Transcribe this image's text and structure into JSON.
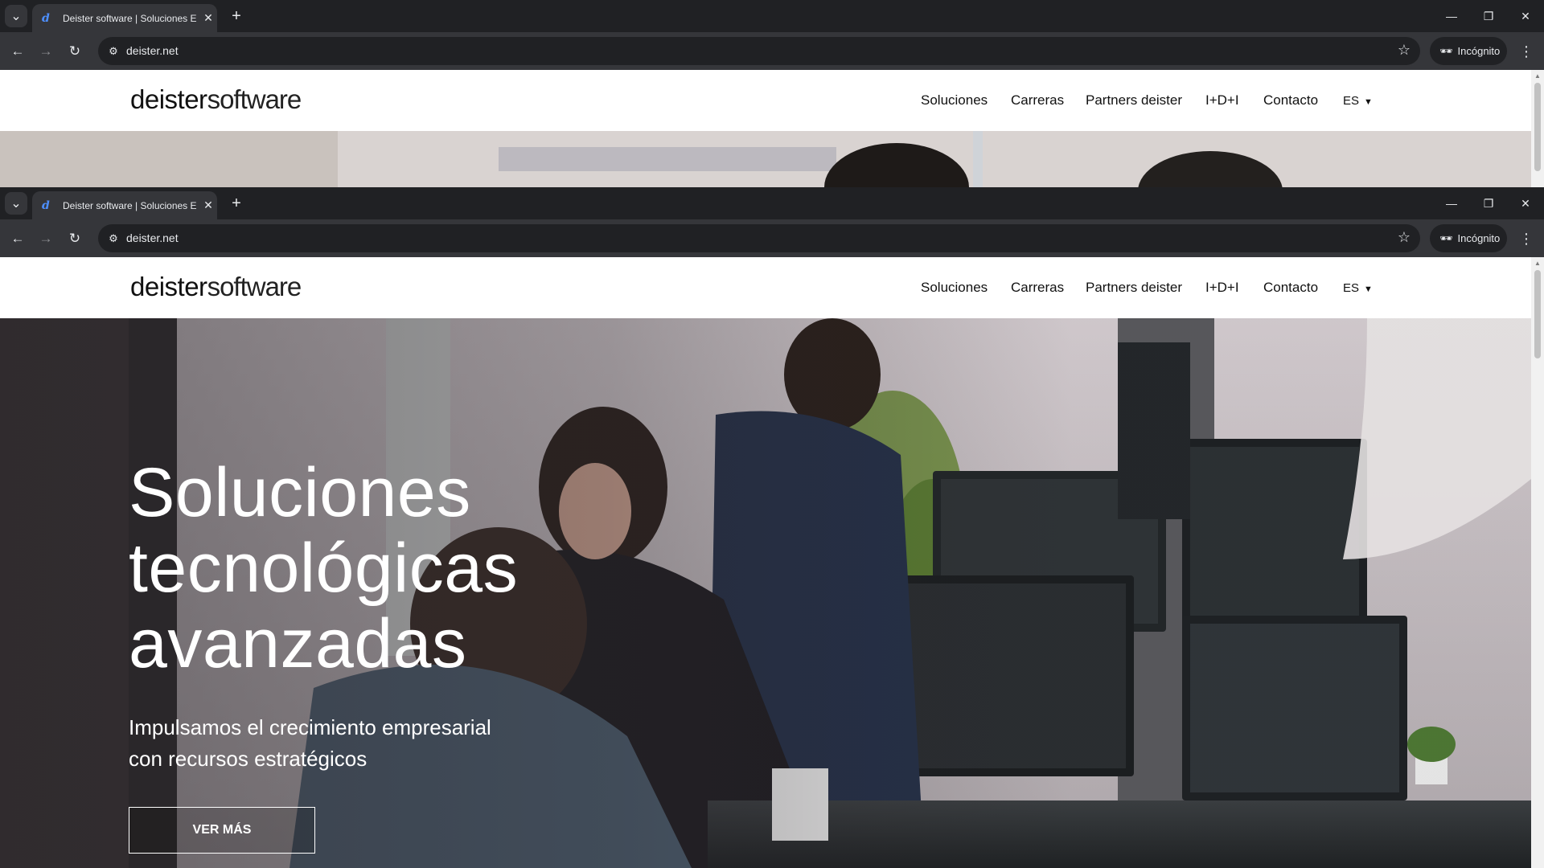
{
  "browser": {
    "tab_title": "Deister software | Soluciones ERP",
    "favicon_glyph": "d",
    "new_tab_label": "+",
    "url": "deister.net",
    "incognito_label": "Incógnito"
  },
  "site": {
    "logo_bold": "deister",
    "logo_light": "software",
    "nav": [
      "Soluciones",
      "Carreras",
      "Partners deister",
      "I+D+I",
      "Contacto"
    ],
    "language": "ES"
  },
  "hero": {
    "title_line1": "Soluciones",
    "title_line2": "tecnológicas",
    "title_line3": "avanzadas",
    "subtitle_line1": "Impulsamos el crecimiento empresarial",
    "subtitle_line2": "con recursos estratégicos",
    "cta": "VER MÁS"
  },
  "colors": {
    "chrome_dark": "#202124",
    "chrome_toolbar": "#35363a",
    "favicon": "#4d8fff",
    "hero_text": "#ffffff"
  },
  "icons": [
    "tab-search-icon",
    "close-icon",
    "new-tab-icon",
    "minimize-icon",
    "restore-icon",
    "window-close-icon",
    "back-icon",
    "forward-icon",
    "reload-icon",
    "site-info-icon",
    "star-icon",
    "incognito-icon",
    "menu-icon",
    "caret-down-icon"
  ]
}
